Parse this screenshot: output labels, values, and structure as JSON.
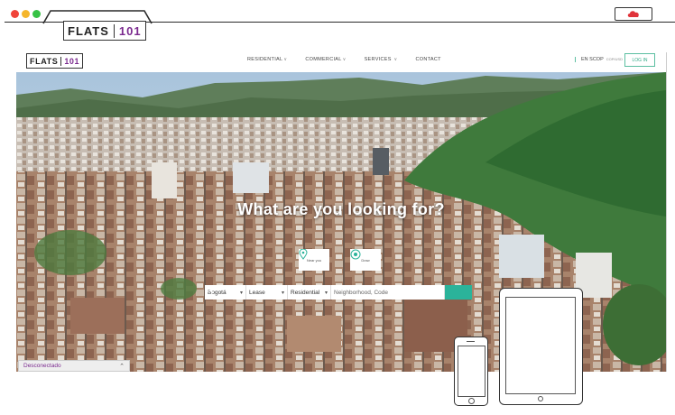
{
  "tab": {
    "logo_word": "FLATS",
    "logo_num": "101"
  },
  "nav": {
    "logo_word": "FLATS",
    "logo_num": "101",
    "items": [
      {
        "label": "RESIDENTIAL",
        "has_dropdown": true
      },
      {
        "label": "COMMERCIAL",
        "has_dropdown": true
      },
      {
        "label": "SERVICES",
        "has_dropdown": true
      },
      {
        "label": "CONTACT",
        "has_dropdown": false
      }
    ],
    "lang": "EN SCOP",
    "currency": "COP/USD",
    "login": "LOG IN"
  },
  "hero": {
    "title": "What are you looking for?",
    "quick_buttons": [
      {
        "label": "Near you",
        "icon": "map-pin-icon"
      },
      {
        "label": "Draw",
        "icon": "draw-area-icon"
      }
    ],
    "search": {
      "city": "Bogotá",
      "deal": "Lease",
      "type": "Residential",
      "placeholder": "Neighborhood, Code"
    }
  },
  "status_bar": {
    "label": "Desconectado"
  },
  "colors": {
    "brand_purple": "#7b2a8f",
    "accent_teal": "#2bb39a",
    "chrome_red": "#f0443a",
    "chrome_yellow": "#f5b62c",
    "chrome_green": "#37c246"
  }
}
